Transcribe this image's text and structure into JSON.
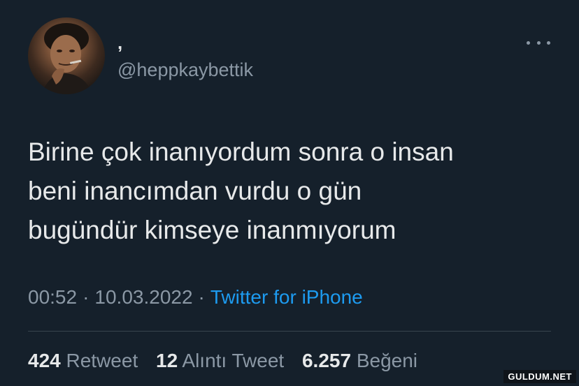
{
  "user": {
    "display_name": ",",
    "handle": "@heppkaybettik"
  },
  "tweet": {
    "lines": [
      "Birine çok inanıyordum sonra o insan",
      "beni inancımdan vurdu o gün",
      "bugündür kimseye inanmıyorum"
    ],
    "time": "00:52",
    "date": "10.03.2022",
    "separator": "·",
    "source": "Twitter for iPhone"
  },
  "stats": {
    "retweets": {
      "count": "424",
      "label": "Retweet"
    },
    "quotes": {
      "count": "12",
      "label": "Alıntı Tweet"
    },
    "likes": {
      "count": "6.257",
      "label": "Beğeni"
    }
  },
  "watermark": "GULDUM.NET",
  "colors": {
    "background": "#15202b",
    "text": "#e7e9ea",
    "muted": "#8b98a5",
    "link": "#1d9bf0",
    "divider": "#38444d"
  },
  "icons": {
    "more": "more-horizontal-icon",
    "avatar": "profile-photo"
  }
}
